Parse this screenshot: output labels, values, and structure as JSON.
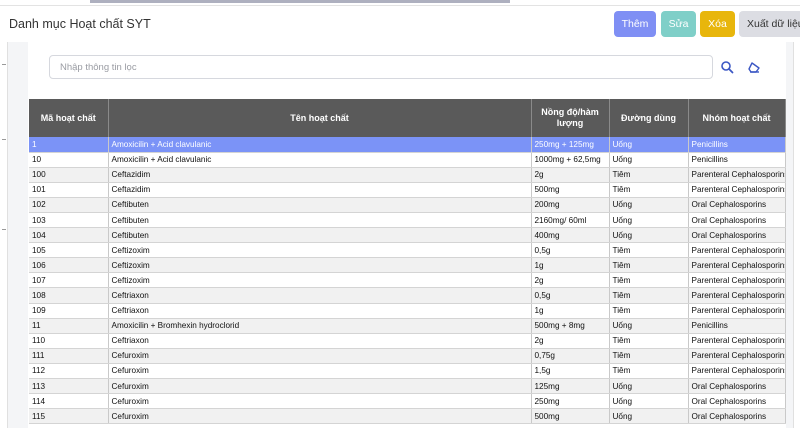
{
  "header": {
    "title": "Danh mục Hoạt chất SYT",
    "buttons": {
      "add": "Thêm",
      "edit": "Sửa",
      "delete": "Xóa",
      "export": "Xuất dữ liệu"
    }
  },
  "search": {
    "placeholder": "Nhập thông tin lọc",
    "value": ""
  },
  "table": {
    "columns": [
      "Mã hoạt chất",
      "Tên hoạt chất",
      "Nồng độ/hàm lượng",
      "Đường dùng",
      "Nhóm hoạt chất"
    ],
    "rows": [
      [
        "1",
        "Amoxicilin + Acid clavulanic",
        "250mg + 125mg",
        "Uống",
        "Penicillins"
      ],
      [
        "10",
        "Amoxicilin + Acid clavulanic",
        "1000mg + 62,5mg",
        "Uống",
        "Penicillins"
      ],
      [
        "100",
        "Ceftazidim",
        "2g",
        "Tiêm",
        "Parenteral Cephalosporins"
      ],
      [
        "101",
        "Ceftazidim",
        "500mg",
        "Tiêm",
        "Parenteral Cephalosporins"
      ],
      [
        "102",
        "Ceftibuten",
        "200mg",
        "Uống",
        "Oral Cephalosporins"
      ],
      [
        "103",
        "Ceftibuten",
        "2160mg/ 60ml",
        "Uống",
        "Oral Cephalosporins"
      ],
      [
        "104",
        "Ceftibuten",
        "400mg",
        "Uống",
        "Oral Cephalosporins"
      ],
      [
        "105",
        "Ceftizoxim",
        "0,5g",
        "Tiêm",
        "Parenteral Cephalosporins"
      ],
      [
        "106",
        "Ceftizoxim",
        "1g",
        "Tiêm",
        "Parenteral Cephalosporins"
      ],
      [
        "107",
        "Ceftizoxim",
        "2g",
        "Tiêm",
        "Parenteral Cephalosporins"
      ],
      [
        "108",
        "Ceftriaxon",
        "0,5g",
        "Tiêm",
        "Parenteral Cephalosporins"
      ],
      [
        "109",
        "Ceftriaxon",
        "1g",
        "Tiêm",
        "Parenteral Cephalosporins"
      ],
      [
        "11",
        "Amoxicilin + Bromhexin hydroclorid",
        "500mg + 8mg",
        "Uống",
        "Penicillins"
      ],
      [
        "110",
        "Ceftriaxon",
        "2g",
        "Tiêm",
        "Parenteral Cephalosporins"
      ],
      [
        "111",
        "Cefuroxim",
        "0,75g",
        "Tiêm",
        "Parenteral Cephalosporins"
      ],
      [
        "112",
        "Cefuroxim",
        "1,5g",
        "Tiêm",
        "Parenteral Cephalosporins"
      ],
      [
        "113",
        "Cefuroxim",
        "125mg",
        "Uống",
        "Oral Cephalosporins"
      ],
      [
        "114",
        "Cefuroxim",
        "250mg",
        "Uống",
        "Oral Cephalosporins"
      ],
      [
        "115",
        "Cefuroxim",
        "500mg",
        "Uống",
        "Oral Cephalosporins"
      ]
    ]
  },
  "colors": {
    "selected_row": "#7b93f7",
    "header_bg": "#5a5a5a"
  },
  "icons": {
    "search": "search-icon",
    "clear": "eraser-icon"
  }
}
